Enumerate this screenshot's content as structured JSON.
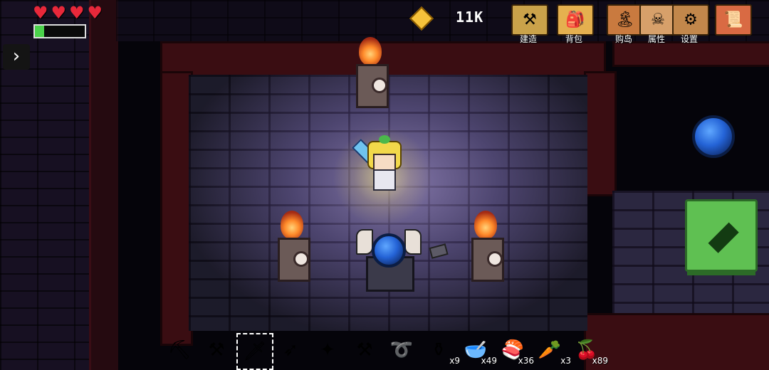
{
  "hud": {
    "hearts": [
      "♥",
      "♥",
      "♥",
      "♥"
    ],
    "energy_fraction": 0.18,
    "currency": "11K",
    "expand_icon": "chevron-right-icon",
    "expand_glyph": "›"
  },
  "menu": [
    {
      "name": "build",
      "label": "建造",
      "icon": "anvil-icon",
      "glyph": "⚒",
      "bg": "#caa24a"
    },
    {
      "name": "backpack",
      "label": "背包",
      "icon": "backpack-icon",
      "glyph": "🎒",
      "bg": "#e5b04f"
    },
    {
      "name": "buy-island",
      "label": "购岛",
      "icon": "island-icon",
      "glyph": "🏝",
      "bg": "#c97a3f"
    },
    {
      "name": "attributes",
      "label": "属性",
      "icon": "skull-icon",
      "glyph": "☠",
      "bg": "#d7a06a"
    },
    {
      "name": "settings",
      "label": "设置",
      "icon": "gear-icon",
      "glyph": "⚙",
      "bg": "#c2874b"
    },
    {
      "name": "map",
      "label": "",
      "icon": "scroll-map-icon",
      "glyph": "📜",
      "bg": "#d96a43"
    }
  ],
  "hotbar": [
    {
      "icon": "pickaxe-icon",
      "glyph": "⛏",
      "count": ""
    },
    {
      "icon": "shovel-icon",
      "glyph": "⚒",
      "count": ""
    },
    {
      "icon": "sword-icon",
      "glyph": "🗡",
      "count": "",
      "selected": true
    },
    {
      "icon": "bow-icon",
      "glyph": "➶",
      "count": ""
    },
    {
      "icon": "wand-icon",
      "glyph": "✦",
      "count": ""
    },
    {
      "icon": "hammer-icon",
      "glyph": "⚒",
      "count": ""
    },
    {
      "icon": "fishing-rod-icon",
      "glyph": "➰",
      "count": ""
    },
    {
      "icon": "jar-icon",
      "glyph": "⚱",
      "count": "x9"
    },
    {
      "icon": "bowl-icon",
      "glyph": "🥣",
      "count": "x49"
    },
    {
      "icon": "sushi-icon",
      "glyph": "🍣",
      "count": "x36"
    },
    {
      "icon": "radish-icon",
      "glyph": "🥕",
      "count": "x3"
    },
    {
      "icon": "berries-icon",
      "glyph": "🍒",
      "count": "x89"
    }
  ],
  "colors": {
    "heart": "#e8283a",
    "attack": "#5fc052",
    "orb": "#2463d6",
    "gem": "#f7c23b"
  }
}
